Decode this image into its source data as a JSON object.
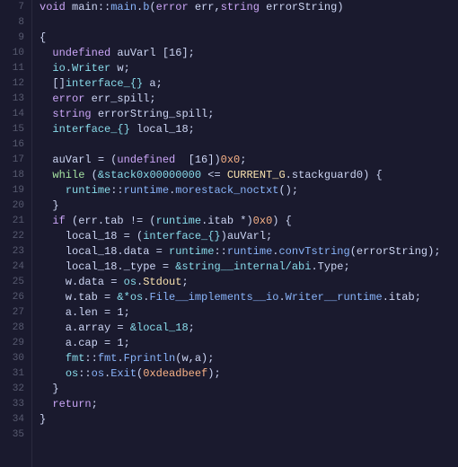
{
  "lines": [
    {
      "num": "7",
      "tokens": [
        {
          "t": "kw",
          "v": "void"
        },
        {
          "t": "white",
          "v": " main"
        },
        {
          "t": "white",
          "v": "::"
        },
        {
          "t": "fn",
          "v": "main"
        },
        {
          "t": "white",
          "v": "."
        },
        {
          "t": "fn",
          "v": "b"
        },
        {
          "t": "white",
          "v": "("
        },
        {
          "t": "kw",
          "v": "error"
        },
        {
          "t": "white",
          "v": " err,"
        },
        {
          "t": "kw",
          "v": "string"
        },
        {
          "t": "white",
          "v": " errorString)"
        }
      ]
    },
    {
      "num": "8",
      "tokens": []
    },
    {
      "num": "9",
      "tokens": [
        {
          "t": "white",
          "v": "{"
        }
      ]
    },
    {
      "num": "10",
      "tokens": [
        {
          "t": "white",
          "v": "  "
        },
        {
          "t": "kw",
          "v": "undefined"
        },
        {
          "t": "white",
          "v": " auVarl "
        },
        {
          "t": "white",
          "v": "[16];"
        }
      ]
    },
    {
      "num": "11",
      "tokens": [
        {
          "t": "white",
          "v": "  "
        },
        {
          "t": "cyan",
          "v": "io"
        },
        {
          "t": "white",
          "v": "."
        },
        {
          "t": "cyan",
          "v": "Writer"
        },
        {
          "t": "white",
          "v": " w;"
        }
      ]
    },
    {
      "num": "12",
      "tokens": [
        {
          "t": "white",
          "v": "  "
        },
        {
          "t": "white",
          "v": "[]"
        },
        {
          "t": "cyan",
          "v": "interface_{}"
        },
        {
          "t": "white",
          "v": " a;"
        }
      ]
    },
    {
      "num": "13",
      "tokens": [
        {
          "t": "white",
          "v": "  "
        },
        {
          "t": "kw",
          "v": "error"
        },
        {
          "t": "white",
          "v": " err_spill;"
        }
      ]
    },
    {
      "num": "14",
      "tokens": [
        {
          "t": "white",
          "v": "  "
        },
        {
          "t": "kw",
          "v": "string"
        },
        {
          "t": "white",
          "v": " errorString_spill;"
        }
      ]
    },
    {
      "num": "15",
      "tokens": [
        {
          "t": "white",
          "v": "  "
        },
        {
          "t": "cyan",
          "v": "interface_{}"
        },
        {
          "t": "white",
          "v": " local_18;"
        }
      ]
    },
    {
      "num": "16",
      "tokens": []
    },
    {
      "num": "17",
      "tokens": [
        {
          "t": "white",
          "v": "  "
        },
        {
          "t": "white",
          "v": "auVarl = ("
        },
        {
          "t": "kw",
          "v": "undefined"
        },
        {
          "t": "white",
          "v": "  [16])"
        },
        {
          "t": "num",
          "v": "0x0"
        },
        {
          "t": "white",
          "v": ";"
        }
      ]
    },
    {
      "num": "18",
      "tokens": [
        {
          "t": "white",
          "v": "  "
        },
        {
          "t": "green-kw",
          "v": "while"
        },
        {
          "t": "white",
          "v": " ("
        },
        {
          "t": "cyan",
          "v": "&stack0x00000000"
        },
        {
          "t": "white",
          "v": " <= "
        },
        {
          "t": "yellow",
          "v": "CURRENT_G"
        },
        {
          "t": "white",
          "v": ".stackguard0) {"
        }
      ]
    },
    {
      "num": "19",
      "tokens": [
        {
          "t": "white",
          "v": "    "
        },
        {
          "t": "cyan",
          "v": "runtime"
        },
        {
          "t": "white",
          "v": "::"
        },
        {
          "t": "fn",
          "v": "runtime"
        },
        {
          "t": "white",
          "v": "."
        },
        {
          "t": "fn",
          "v": "morestack_noctxt"
        },
        {
          "t": "white",
          "v": "();"
        }
      ]
    },
    {
      "num": "20",
      "tokens": [
        {
          "t": "white",
          "v": "  }"
        }
      ]
    },
    {
      "num": "21",
      "tokens": [
        {
          "t": "white",
          "v": "  "
        },
        {
          "t": "kw",
          "v": "if"
        },
        {
          "t": "white",
          "v": " (err.tab != ("
        },
        {
          "t": "cyan",
          "v": "runtime"
        },
        {
          "t": "white",
          "v": ".itab *)"
        },
        {
          "t": "num",
          "v": "0x0"
        },
        {
          "t": "white",
          "v": ") {"
        }
      ]
    },
    {
      "num": "22",
      "tokens": [
        {
          "t": "white",
          "v": "    local_18 = ("
        },
        {
          "t": "cyan",
          "v": "interface_{}"
        },
        {
          "t": "white",
          "v": ")auVarl;"
        }
      ]
    },
    {
      "num": "23",
      "tokens": [
        {
          "t": "white",
          "v": "    local_18.data = "
        },
        {
          "t": "cyan",
          "v": "runtime"
        },
        {
          "t": "white",
          "v": "::"
        },
        {
          "t": "fn",
          "v": "runtime"
        },
        {
          "t": "white",
          "v": "."
        },
        {
          "t": "fn",
          "v": "convTstring"
        },
        {
          "t": "white",
          "v": "(errorString);"
        }
      ]
    },
    {
      "num": "24",
      "tokens": [
        {
          "t": "white",
          "v": "    local_18._type = "
        },
        {
          "t": "cyan",
          "v": "&string__internal/abi"
        },
        {
          "t": "white",
          "v": ".Type;"
        }
      ]
    },
    {
      "num": "25",
      "tokens": [
        {
          "t": "white",
          "v": "    w.data = "
        },
        {
          "t": "cyan",
          "v": "os"
        },
        {
          "t": "white",
          "v": "."
        },
        {
          "t": "yellow",
          "v": "Stdout"
        },
        {
          "t": "white",
          "v": ";"
        }
      ]
    },
    {
      "num": "26",
      "tokens": [
        {
          "t": "white",
          "v": "    w.tab = "
        },
        {
          "t": "cyan",
          "v": "&*os"
        },
        {
          "t": "white",
          "v": "."
        },
        {
          "t": "fn",
          "v": "File__implements__io"
        },
        {
          "t": "white",
          "v": "."
        },
        {
          "t": "fn",
          "v": "Writer__runtime"
        },
        {
          "t": "white",
          "v": ".itab;"
        }
      ]
    },
    {
      "num": "27",
      "tokens": [
        {
          "t": "white",
          "v": "    a.len = 1;"
        }
      ]
    },
    {
      "num": "28",
      "tokens": [
        {
          "t": "white",
          "v": "    a.array = "
        },
        {
          "t": "cyan",
          "v": "&local_18"
        },
        {
          "t": "white",
          "v": ";"
        }
      ]
    },
    {
      "num": "29",
      "tokens": [
        {
          "t": "white",
          "v": "    a.cap = 1;"
        }
      ]
    },
    {
      "num": "30",
      "tokens": [
        {
          "t": "white",
          "v": "    "
        },
        {
          "t": "cyan",
          "v": "fmt"
        },
        {
          "t": "white",
          "v": "::"
        },
        {
          "t": "fn",
          "v": "fmt"
        },
        {
          "t": "white",
          "v": "."
        },
        {
          "t": "fn",
          "v": "Fprintln"
        },
        {
          "t": "white",
          "v": "(w,a);"
        }
      ]
    },
    {
      "num": "31",
      "tokens": [
        {
          "t": "white",
          "v": "    "
        },
        {
          "t": "cyan",
          "v": "os"
        },
        {
          "t": "white",
          "v": "::"
        },
        {
          "t": "fn",
          "v": "os"
        },
        {
          "t": "white",
          "v": "."
        },
        {
          "t": "fn",
          "v": "Exit"
        },
        {
          "t": "white",
          "v": "("
        },
        {
          "t": "num",
          "v": "0xdeadbeef"
        },
        {
          "t": "white",
          "v": ");"
        }
      ]
    },
    {
      "num": "32",
      "tokens": [
        {
          "t": "white",
          "v": "  }"
        }
      ]
    },
    {
      "num": "33",
      "tokens": [
        {
          "t": "white",
          "v": "  "
        },
        {
          "t": "kw",
          "v": "return"
        },
        {
          "t": "white",
          "v": ";"
        }
      ]
    },
    {
      "num": "34",
      "tokens": [
        {
          "t": "white",
          "v": "}"
        }
      ]
    },
    {
      "num": "35",
      "tokens": []
    }
  ]
}
